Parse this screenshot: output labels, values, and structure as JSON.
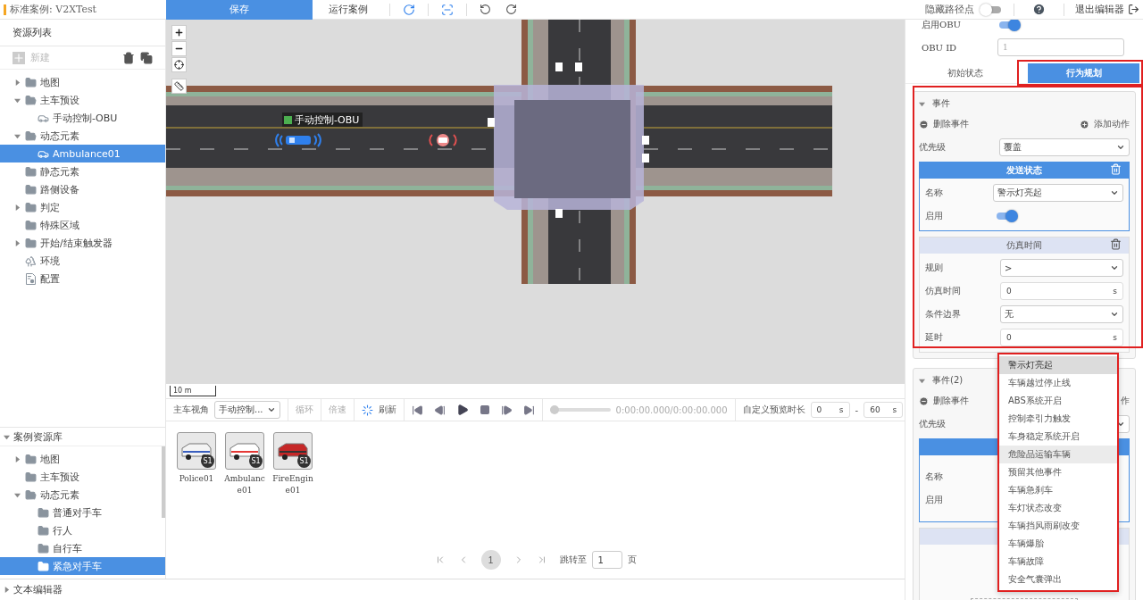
{
  "header": {
    "case_title": "标准案例: V2XTest",
    "save_button": "保存",
    "run_button": "运行案例",
    "hide_waypoints": {
      "label": "隐藏路径点",
      "on": false
    },
    "exit_button": "退出编辑器"
  },
  "resource_list": {
    "title": "资源列表",
    "new_button": {
      "label": "新建",
      "disabled": true
    },
    "tree": [
      {
        "label": "地图",
        "kind": "folder",
        "expanded": false,
        "selected": false
      },
      {
        "label": "主车预设",
        "kind": "folder",
        "expanded": true,
        "selected": false,
        "children": [
          {
            "label": "手动控制-OBU",
            "kind": "vehicle",
            "selected": false
          }
        ]
      },
      {
        "label": "动态元素",
        "kind": "folder",
        "expanded": true,
        "selected": false,
        "children": [
          {
            "label": "Ambulance01",
            "kind": "vehicle",
            "selected": true
          }
        ]
      },
      {
        "label": "静态元素",
        "kind": "folder",
        "selected": false
      },
      {
        "label": "路侧设备",
        "kind": "folder",
        "selected": false
      },
      {
        "label": "判定",
        "kind": "folder",
        "expanded": false,
        "selected": false
      },
      {
        "label": "特殊区域",
        "kind": "folder",
        "selected": false
      },
      {
        "label": "开始/结束触发器",
        "kind": "folder",
        "expanded": false,
        "selected": false
      },
      {
        "label": "环境",
        "kind": "environment",
        "selected": false
      },
      {
        "label": "配置",
        "kind": "config",
        "selected": false
      }
    ]
  },
  "case_library": {
    "title": "案例资源库",
    "expanded": true,
    "tree": [
      {
        "label": "地图",
        "kind": "folder",
        "expanded": false,
        "selected": false
      },
      {
        "label": "主车预设",
        "kind": "folder",
        "selected": false
      },
      {
        "label": "动态元素",
        "kind": "folder",
        "expanded": true,
        "selected": false,
        "children": [
          {
            "label": "普通对手车",
            "kind": "folder",
            "selected": false
          },
          {
            "label": "行人",
            "kind": "folder",
            "selected": false
          },
          {
            "label": "自行车",
            "kind": "folder",
            "selected": false
          },
          {
            "label": "紧急对手车",
            "kind": "folder",
            "selected": true
          }
        ]
      }
    ]
  },
  "text_editor": {
    "title": "文本编辑器",
    "expanded": false
  },
  "map": {
    "vehicle_label": "手动控制-OBU",
    "scale": "10 m"
  },
  "playback": {
    "view_label": "主车视角",
    "view_select": "手动控制...",
    "loop": "循环",
    "speed": "倍速",
    "refresh": "刷新",
    "level": 0,
    "time": "0:00:00.000/0:00:00.000",
    "duration_label": "自定义预览时长",
    "start": "0",
    "start_unit": "s",
    "separator": "-",
    "end": "60",
    "end_unit": "s"
  },
  "assets": [
    {
      "name": "Police01",
      "badge": "S1",
      "kind": "police"
    },
    {
      "name": "Ambulance01",
      "badge": "S1",
      "kind": "ambulance"
    },
    {
      "name": "FireEngine01",
      "badge": "S1",
      "kind": "fire"
    }
  ],
  "pagination": {
    "pages": [
      {
        "label": "1",
        "selected": true
      }
    ],
    "jump_label": "跳转至",
    "jump_value": "1",
    "page_suffix": "页"
  },
  "properties": {
    "obu_enabled": {
      "label": "启用OBU",
      "on": true
    },
    "obu_id": {
      "label": "OBU ID",
      "placeholder": "1"
    },
    "tabs": [
      {
        "label": "初始状态",
        "selected": false
      },
      {
        "label": "行为规划",
        "selected": true
      }
    ],
    "events": [
      {
        "title": "事件",
        "expanded": true,
        "delete": "删除事件",
        "add": "添加动作",
        "priority_label": "优先级",
        "priority": "覆盖",
        "action": {
          "title": "发送状态",
          "name_label": "名称",
          "name": "警示灯亮起",
          "enable_label": "启用",
          "enabled": true
        },
        "condition": {
          "title": "仿真时间",
          "fields": [
            {
              "label": "规则",
              "value": ">",
              "kind": "select"
            },
            {
              "label": "仿真时间",
              "value": "0",
              "unit": "s",
              "kind": "input"
            },
            {
              "label": "条件边界",
              "value": "无",
              "kind": "select"
            },
            {
              "label": "延时",
              "value": "0",
              "unit": "s",
              "kind": "input"
            }
          ]
        }
      },
      {
        "title": "事件(2)",
        "expanded": true,
        "delete": "删除事件",
        "add": "作",
        "priority_label": "优先级",
        "action": {
          "name_label": "名称",
          "enable_label": "启用"
        }
      }
    ]
  },
  "dropdown": {
    "options": [
      {
        "label": "警示灯亮起",
        "selected": true,
        "hovered": false
      },
      {
        "label": "车辆越过停止线",
        "selected": false,
        "hovered": false
      },
      {
        "label": "ABS系统开启",
        "selected": false,
        "hovered": false
      },
      {
        "label": "控制牵引力触发",
        "selected": false,
        "hovered": false
      },
      {
        "label": "车身稳定系统开启",
        "selected": false,
        "hovered": false
      },
      {
        "label": "危险品运输车辆",
        "selected": false,
        "hovered": true
      },
      {
        "label": "预留其他事件",
        "selected": false,
        "hovered": false
      },
      {
        "label": "车辆急刹车",
        "selected": false,
        "hovered": false
      },
      {
        "label": "车灯状态改变",
        "selected": false,
        "hovered": false
      },
      {
        "label": "车辆挡风雨刷改变",
        "selected": false,
        "hovered": false
      },
      {
        "label": "车辆爆胎",
        "selected": false,
        "hovered": false
      },
      {
        "label": "车辆故障",
        "selected": false,
        "hovered": false
      },
      {
        "label": "安全气囊弹出",
        "selected": false,
        "hovered": false
      }
    ]
  }
}
